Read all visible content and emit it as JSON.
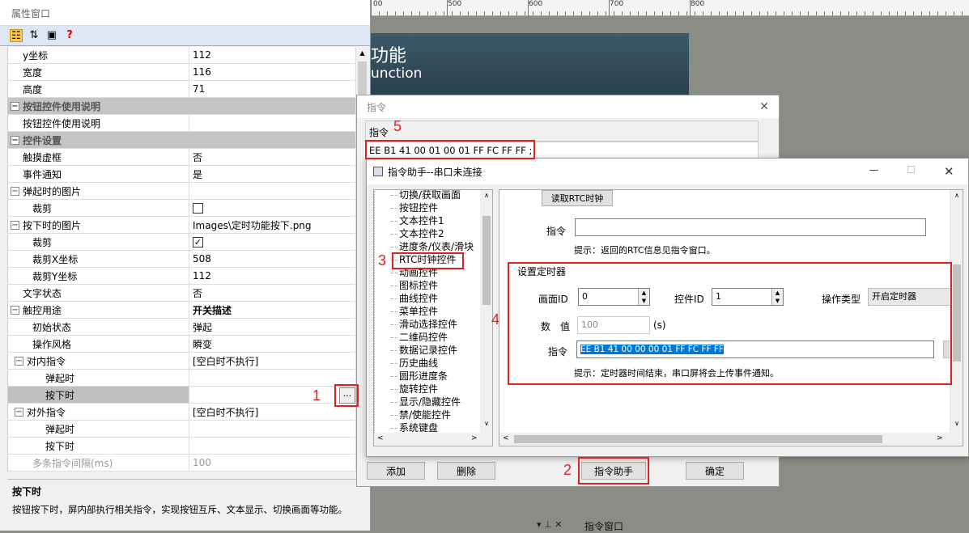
{
  "prop_window": {
    "title": "属性窗口",
    "toolbar_help": "?",
    "rows": [
      {
        "label": "y坐标",
        "value": "112",
        "indent": 1,
        "type": "prop"
      },
      {
        "label": "宽度",
        "value": "116",
        "indent": 1,
        "type": "prop"
      },
      {
        "label": "高度",
        "value": "71",
        "indent": 1,
        "type": "prop"
      },
      {
        "label": "按钮控件使用说明",
        "value": "",
        "indent": 0,
        "type": "cat"
      },
      {
        "label": "按钮控件使用说明",
        "value": "",
        "indent": 1,
        "type": "prop"
      },
      {
        "label": "控件设置",
        "value": "",
        "indent": 0,
        "type": "cat"
      },
      {
        "label": "触摸虚框",
        "value": "否",
        "indent": 1,
        "type": "prop"
      },
      {
        "label": "事件通知",
        "value": "是",
        "indent": 1,
        "type": "prop"
      },
      {
        "label": "弹起时的图片",
        "value": "",
        "indent": 0,
        "type": "group"
      },
      {
        "label": "裁剪",
        "value": "",
        "indent": 2,
        "type": "check",
        "checked": false
      },
      {
        "label": "按下时的图片",
        "value": "Images\\定时功能按下.png",
        "indent": 0,
        "type": "group"
      },
      {
        "label": "裁剪",
        "value": "",
        "indent": 2,
        "type": "check",
        "checked": true
      },
      {
        "label": "裁剪X坐标",
        "value": "508",
        "indent": 2,
        "type": "prop"
      },
      {
        "label": "裁剪Y坐标",
        "value": "112",
        "indent": 2,
        "type": "prop"
      },
      {
        "label": "文字状态",
        "value": "否",
        "indent": 1,
        "type": "prop"
      },
      {
        "label": "触控用途",
        "value": "开关描述",
        "indent": 0,
        "type": "group",
        "bold": true
      },
      {
        "label": "初始状态",
        "value": "弹起",
        "indent": 2,
        "type": "prop"
      },
      {
        "label": "操作风格",
        "value": "瞬变",
        "indent": 2,
        "type": "prop"
      },
      {
        "label": "对内指令",
        "value": "[空白时不执行]",
        "indent": 1,
        "type": "group"
      },
      {
        "label": "弹起时",
        "value": "",
        "indent": 3,
        "type": "prop"
      },
      {
        "label": "按下时",
        "value": "",
        "indent": 3,
        "type": "sel"
      },
      {
        "label": "对外指令",
        "value": "[空白时不执行]",
        "indent": 1,
        "type": "group"
      },
      {
        "label": "弹起时",
        "value": "",
        "indent": 3,
        "type": "prop"
      },
      {
        "label": "按下时",
        "value": "",
        "indent": 3,
        "type": "prop"
      },
      {
        "label": "多条指令间隔(ms)",
        "value": "100",
        "indent": 2,
        "type": "grey"
      }
    ],
    "ellipsis": "...",
    "desc_title": "按下时",
    "desc_text": "按钮按下时，屏内部执行相关指令，实现按钮互斥、文本显示、切换画面等功能。"
  },
  "ruler": {
    "labels": [
      "500",
      "600",
      "700",
      "800"
    ]
  },
  "banner": {
    "line1": "功能",
    "line2": "unction"
  },
  "cmd_window": {
    "title": "指令",
    "close": "✕",
    "label": "指令",
    "value": "EE B1 41 00 01 00 01 FF FC FF FF ;",
    "add": "添加",
    "delete": "删除",
    "helper": "指令助手",
    "ok": "确定"
  },
  "helper_window": {
    "title": "指令助手--串口未连接",
    "minimize": "—",
    "maximize": "☐",
    "close": "✕",
    "tree": [
      "切换/获取画面",
      "按钮控件",
      "文本控件1",
      "文本控件2",
      "进度条/仪表/滑块",
      "RTC时钟控件",
      "动画控件",
      "图标控件",
      "曲线控件",
      "菜单控件",
      "滑动选择控件",
      "二维码控件",
      "数据记录控件",
      "历史曲线",
      "圆形进度条",
      "旋转控件",
      "显示/隐藏控件",
      "禁/使能控件",
      "系统键盘"
    ],
    "read_rtc": "读取RTC时钟",
    "cmd_label": "指令",
    "cmd_value": "",
    "tip1": "提示：返回的RTC信息见指令窗口。",
    "timer_group": "设置定时器",
    "screen_id_label": "画面ID",
    "screen_id": "0",
    "ctrl_id_label": "控件ID",
    "ctrl_id": "1",
    "op_type_label": "操作类型",
    "op_type": "开启定时器",
    "value_label": "数　值",
    "value": "100",
    "unit": "(s)",
    "cmd2_label": "指令",
    "cmd2_value": "EE B1 41 00 00 00 01 FF FC FF FF",
    "tip2": "提示：定时器时间结束，串口屏将会上传事件通知。"
  },
  "markers": [
    "1",
    "2",
    "3",
    "4",
    "5"
  ],
  "bottom_tab": "指令窗口",
  "colors": {
    "accent": "#e02020",
    "selection": "#0078d7"
  }
}
